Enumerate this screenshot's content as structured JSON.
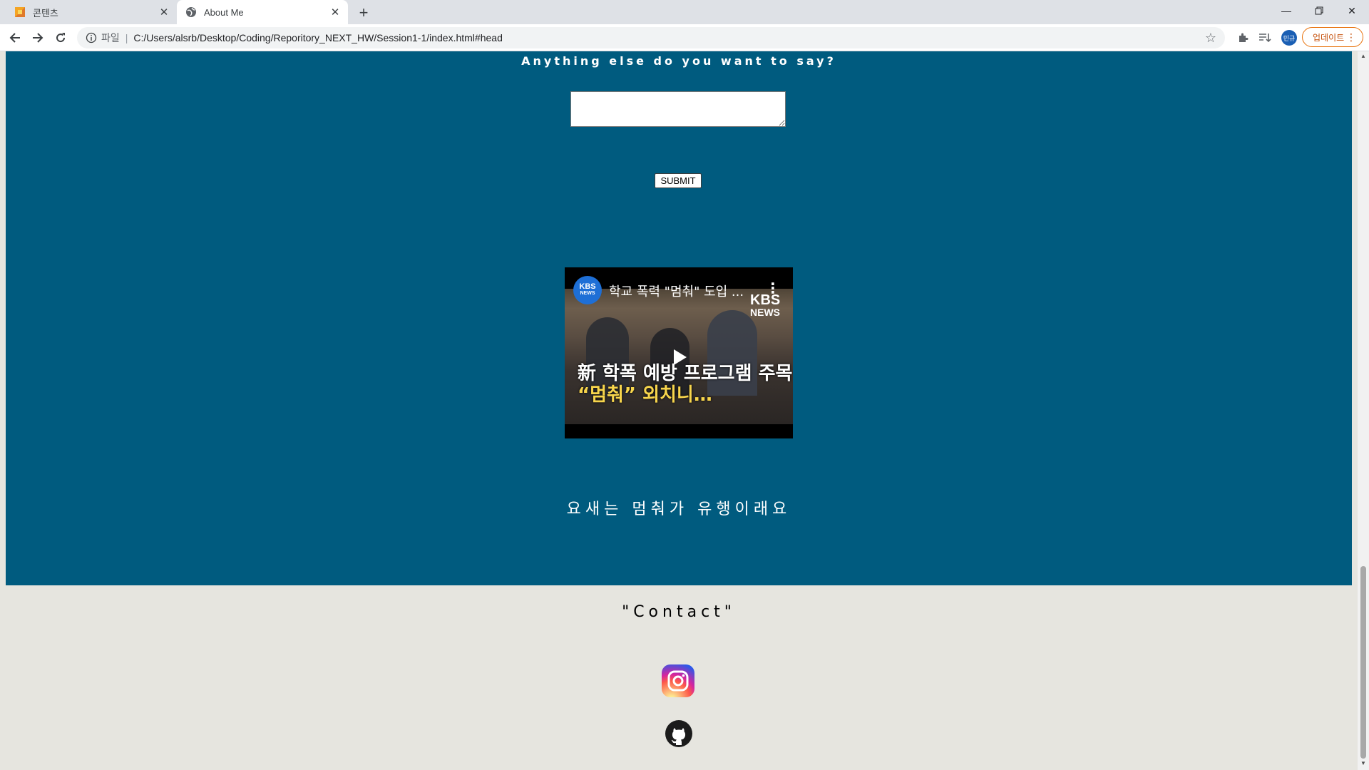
{
  "browser": {
    "tabs": [
      {
        "title": "콘텐츠",
        "active": false,
        "icon": "folder-favicon"
      },
      {
        "title": "About Me",
        "active": true,
        "icon": "globe-favicon"
      }
    ],
    "address": {
      "scheme_label": "파일",
      "url": "C:/Users/alsrb/Desktop/Coding/Reporitory_NEXT_HW/Session1-1/index.html#head"
    },
    "profile_initials": "민규",
    "update_label": "업데이트"
  },
  "page": {
    "question": "Anything else do you want to say?",
    "submit_label": "SUBMIT",
    "video": {
      "channel_logo": "KBS",
      "channel_logo_sub": "NEWS",
      "title": "학교 폭력 \"멈춰\" 도입 ...",
      "watermark_top": "KBS",
      "watermark_bottom": "NEWS",
      "caption_line1": "新 학폭 예방 프로그램 주목",
      "caption_line2": "“멈춰” 외치니…"
    },
    "tagline": "요새는 멈춰가 유행이래요",
    "contact_title": "\"Contact\""
  },
  "colors": {
    "section_blue": "#005b7f",
    "footer_bg": "#e6e5df",
    "update_accent": "#e8710a"
  }
}
